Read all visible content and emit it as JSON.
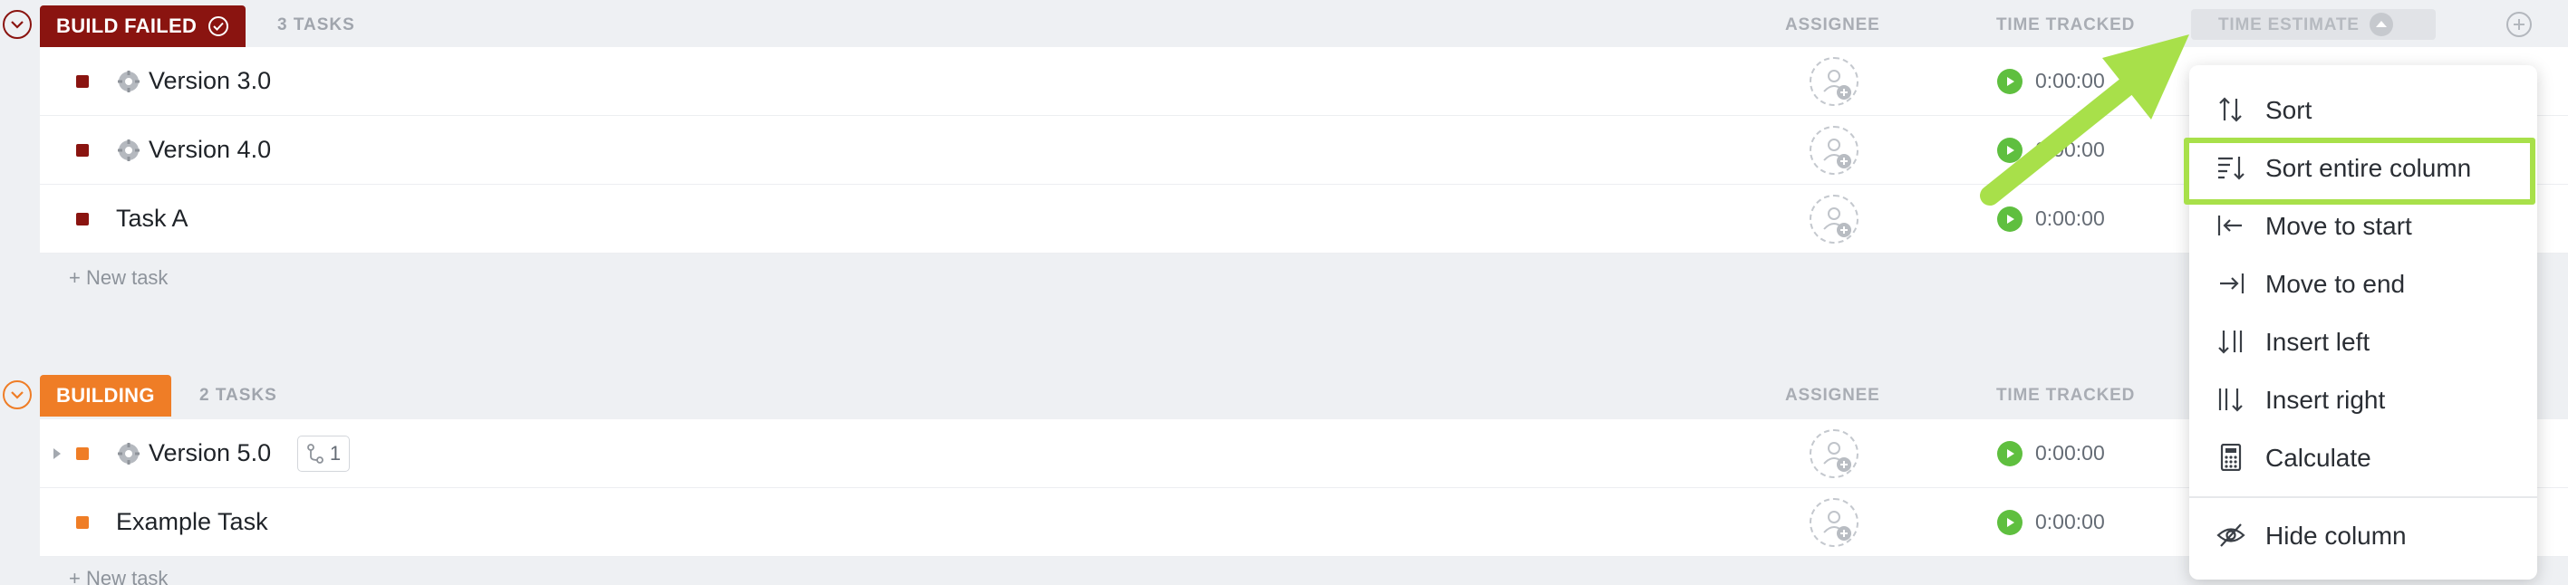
{
  "groups": [
    {
      "status": "BUILD FAILED",
      "count": "3 TASKS",
      "color": "#8a1410",
      "columns": {
        "assignee": "ASSIGNEE",
        "time_tracked": "TIME TRACKED",
        "time_estimate": "TIME ESTIMATE"
      },
      "tasks": [
        {
          "name": "Version 3.0",
          "time": "0:00:00"
        },
        {
          "name": "Version 4.0",
          "time": "0:00:00"
        },
        {
          "name": "Task A",
          "time": "0:00:00"
        }
      ],
      "new_task": "+ New task"
    },
    {
      "status": "BUILDING",
      "count": "2 TASKS",
      "color": "#ef7d26",
      "columns": {
        "assignee": "ASSIGNEE",
        "time_tracked": "TIME TRACKED"
      },
      "tasks": [
        {
          "name": "Version 5.0",
          "time": "0:00:00",
          "subtasks": "1"
        },
        {
          "name": "Example Task",
          "time": "0:00:00"
        }
      ],
      "new_task": "+ New task"
    }
  ],
  "menu": {
    "items": [
      {
        "label": "Sort",
        "icon": "sort-icon"
      },
      {
        "label": "Sort entire column",
        "icon": "sort-column-icon"
      },
      {
        "label": "Move to start",
        "icon": "move-start-icon"
      },
      {
        "label": "Move to end",
        "icon": "move-end-icon"
      },
      {
        "label": "Insert left",
        "icon": "insert-left-icon"
      },
      {
        "label": "Insert right",
        "icon": "insert-right-icon"
      },
      {
        "label": "Calculate",
        "icon": "calculator-icon"
      },
      {
        "label": "Hide column",
        "icon": "eye-off-icon"
      }
    ]
  },
  "colors": {
    "highlight": "#a8e04a",
    "play": "#5fbf3f"
  }
}
